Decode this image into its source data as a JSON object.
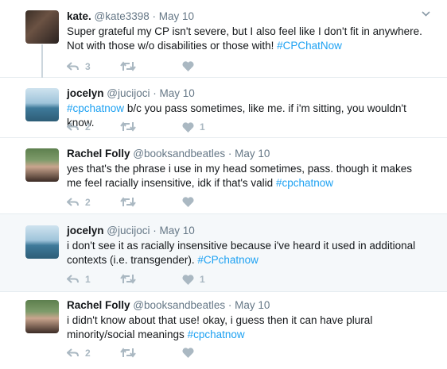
{
  "tweets": [
    {
      "name": "kate.",
      "meta": "@kate3398 · May 10",
      "text_before": "Super grateful my CP isn't severe, but I also feel like I don't fit in anywhere. Not with those w/o disabilities or those with! ",
      "tag": "#CPChatNow",
      "text_after": "",
      "replies": "3",
      "retweets": "",
      "likes": ""
    },
    {
      "name": "jocelyn",
      "meta": "@jucijoci · May 10",
      "text_before": "",
      "tag": "#cpchatnow",
      "text_after": " b/c you pass sometimes, like me. if i'm sitting, you wouldn't know.",
      "replies": "2",
      "retweets": "",
      "likes": "1"
    },
    {
      "name": "Rachel Folly",
      "meta": "@booksandbeatles · May 10",
      "text_before": "yes that's the phrase i use in my head sometimes, pass. though it makes me feel racially insensitive, idk if that's valid ",
      "tag": "#cpchatnow",
      "text_after": "",
      "replies": "2",
      "retweets": "",
      "likes": ""
    },
    {
      "name": "jocelyn",
      "meta": "@jucijoci · May 10",
      "text_before": "i don't see it as racially insensitive because i've heard it used in additional contexts (i.e. transgender). ",
      "tag": "#CPchatnow",
      "text_after": "",
      "replies": "1",
      "retweets": "",
      "likes": "1"
    },
    {
      "name": "Rachel Folly",
      "meta": "@booksandbeatles · May 10",
      "text_before": "i didn't know about that use! okay, i guess then it can have plural minority/social meanings ",
      "tag": "#cpchatnow",
      "text_after": "",
      "replies": "2",
      "retweets": "",
      "likes": ""
    }
  ],
  "icons": {
    "reply": "reply-icon",
    "retweet": "retweet-icon",
    "like": "heart-icon",
    "more": "chevron-down-icon"
  },
  "colors": {
    "hashtag": "#1da1f2",
    "icon": "#aab8c2",
    "meta": "#657786",
    "highlight_bg": "#f5f8fa"
  }
}
